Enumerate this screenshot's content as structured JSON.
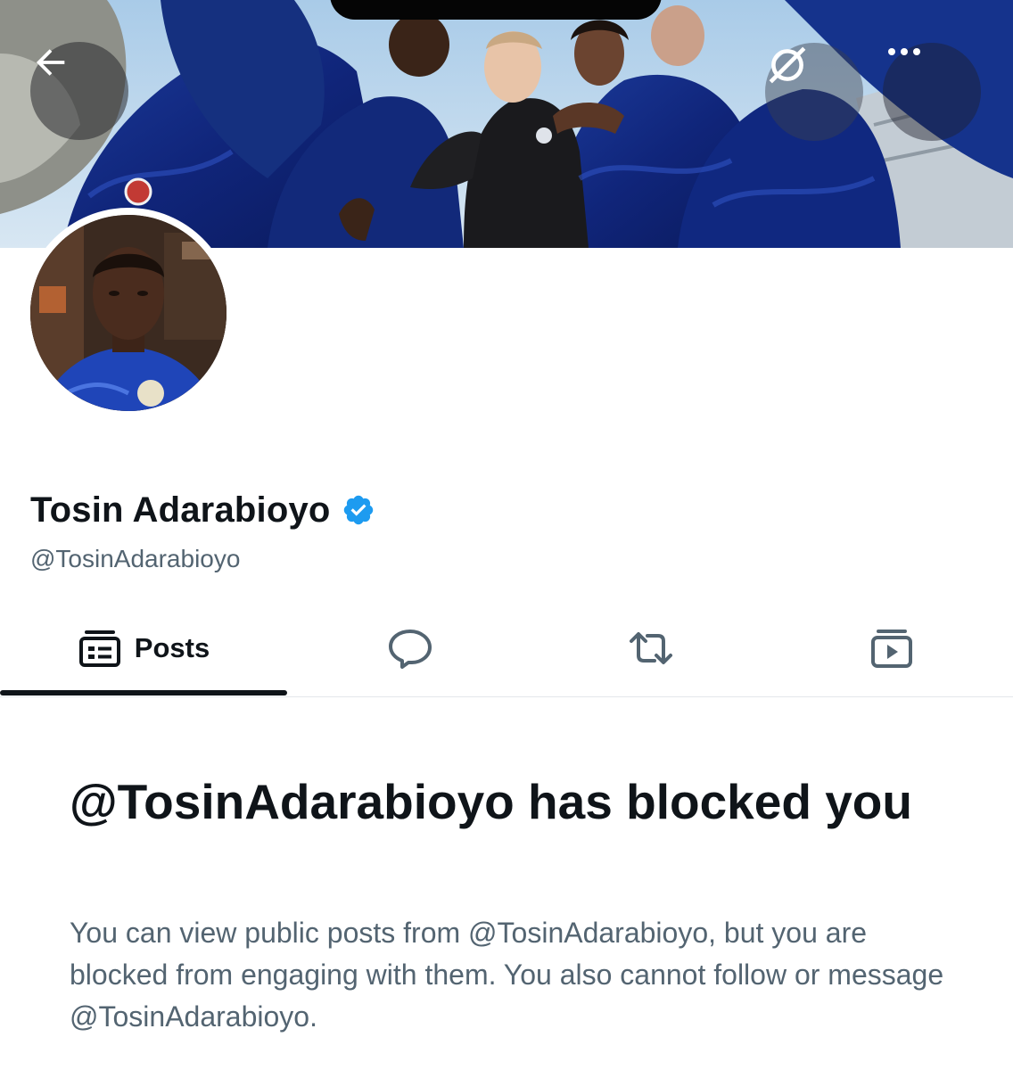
{
  "profile": {
    "display_name": "Tosin Adarabioyo",
    "handle": "@TosinAdarabioyo",
    "verified": true,
    "verified_color": "#1d9bf0"
  },
  "header": {
    "back_icon": "arrow-left-icon",
    "grok_icon": "grok-icon",
    "more_icon": "more-horizontal-icon"
  },
  "tabs": [
    {
      "label": "Posts",
      "icon": "posts-icon",
      "active": true
    },
    {
      "label": "",
      "icon": "reply-icon",
      "active": false
    },
    {
      "label": "",
      "icon": "repost-icon",
      "active": false
    },
    {
      "label": "",
      "icon": "media-icon",
      "active": false
    }
  ],
  "blocked": {
    "title": "@TosinAdarabioyo has blocked you",
    "description": "You can view public posts from @TosinAdarabioyo, but you are blocked from engaging with them. You also cannot follow or message @TosinAdarabioyo."
  },
  "colors": {
    "text_primary": "#0f1419",
    "text_secondary": "#536471",
    "divider": "#e3e7ea"
  }
}
